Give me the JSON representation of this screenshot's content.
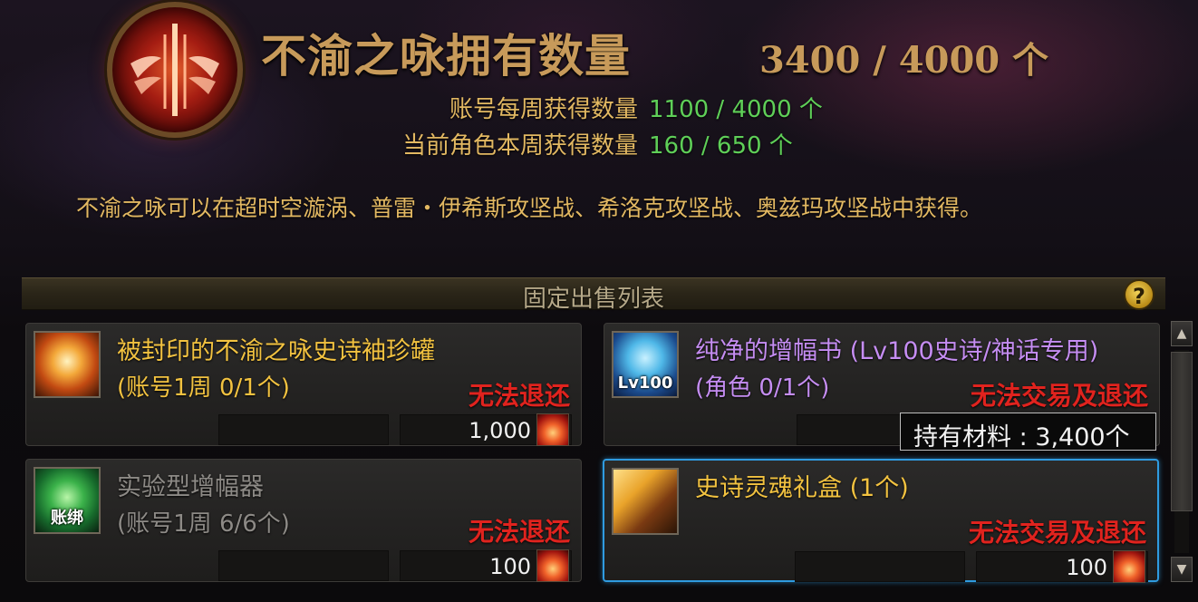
{
  "header": {
    "title": "不渝之咏拥有数量",
    "owned": "3400 / 4000 个",
    "stats": [
      {
        "label": "账号每周获得数量",
        "value": "1100 / 4000 个"
      },
      {
        "label": "当前角色本周获得数量",
        "value": "160 /  650 个"
      }
    ],
    "description": "不渝之咏可以在超时空漩涡、普雷・伊希斯攻坚战、希洛克攻坚战、奥兹玛攻坚战中获得。"
  },
  "list": {
    "title": "固定出售列表",
    "help": "?"
  },
  "colors": {
    "gold_text": "#e2b862",
    "green_value": "#5fcf58",
    "restrict_red": "#e0231e",
    "epic_name": "#f2c240",
    "purple_name": "#c58df2",
    "gray_name": "#8d8a86",
    "selected_border": "#2f9be0"
  },
  "items": [
    {
      "name": "被封印的不渝之咏史诗袖珍罐",
      "limit": "(账号1周 0/1个)",
      "restriction": "无法退还",
      "price": "1,000",
      "icon": "epic-jar-icon",
      "name_color": "#f2c240",
      "limit_color": "#f2c240"
    },
    {
      "name": "纯净的增幅书 (Lv100史诗/神话专用)",
      "limit": "(角色 0/1个)",
      "restriction": "无法交易及退还",
      "price": "",
      "icon": "amplify-book-icon",
      "icon_label": "Lv100",
      "name_color": "#c58df2",
      "limit_color": "#c58df2"
    },
    {
      "name": "实验型增幅器",
      "limit": "(账号1周 6/6个)",
      "restriction": "无法退还",
      "price": "100",
      "icon": "amplifier-icon",
      "icon_label": "账绑",
      "name_color": "#8d8a86",
      "limit_color": "#8d8a86"
    },
    {
      "name": "史诗灵魂礼盒 (1个)",
      "limit": "",
      "restriction": "无法交易及退还",
      "price": "100",
      "icon": "soul-box-icon",
      "name_color": "#f2c240",
      "limit_color": "#f2c240"
    }
  ],
  "tooltip": {
    "text": "持有材料 : 3,400个"
  },
  "scrollbar": {
    "up": "▲",
    "down": "▼"
  }
}
